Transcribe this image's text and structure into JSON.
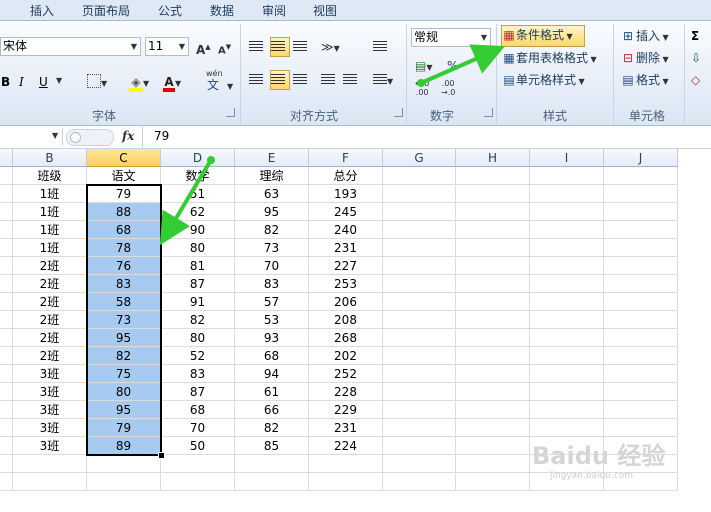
{
  "tabs": [
    "插入",
    "页面布局",
    "公式",
    "数据",
    "审阅",
    "视图"
  ],
  "font_group": {
    "font_name": "宋体",
    "font_size": "11",
    "label": "字体",
    "bold": "B",
    "italic": "I",
    "underline": "U",
    "font_color_letter": "A",
    "phonetic_top": "wén",
    "phonetic_char": "文"
  },
  "align_group": {
    "label": "对齐方式"
  },
  "number_group": {
    "format": "常规",
    "percent": "%",
    "label": "数字"
  },
  "style_group": {
    "conditional": "条件格式",
    "table_format": "套用表格格式",
    "cell_style": "单元格样式",
    "label": "样式"
  },
  "cells_group": {
    "insert": "插入",
    "delete": "删除",
    "format": "格式",
    "label": "单元格"
  },
  "formula_bar": {
    "fx": "fx",
    "value": "79"
  },
  "columns": [
    "B",
    "C",
    "D",
    "E",
    "F",
    "G",
    "H",
    "I",
    "J"
  ],
  "headers": [
    "班级",
    "语文",
    "数学",
    "理综",
    "总分"
  ],
  "rows": [
    [
      "1班",
      "79",
      "51",
      "63",
      "193"
    ],
    [
      "1班",
      "88",
      "62",
      "95",
      "245"
    ],
    [
      "1班",
      "68",
      "90",
      "82",
      "240"
    ],
    [
      "1班",
      "78",
      "80",
      "73",
      "231"
    ],
    [
      "2班",
      "76",
      "81",
      "70",
      "227"
    ],
    [
      "2班",
      "83",
      "87",
      "83",
      "253"
    ],
    [
      "2班",
      "58",
      "91",
      "57",
      "206"
    ],
    [
      "2班",
      "73",
      "82",
      "53",
      "208"
    ],
    [
      "2班",
      "95",
      "80",
      "93",
      "268"
    ],
    [
      "2班",
      "82",
      "52",
      "68",
      "202"
    ],
    [
      "3班",
      "75",
      "83",
      "94",
      "252"
    ],
    [
      "3班",
      "80",
      "87",
      "61",
      "228"
    ],
    [
      "3班",
      "95",
      "68",
      "66",
      "229"
    ],
    [
      "3班",
      "79",
      "70",
      "82",
      "231"
    ],
    [
      "3班",
      "89",
      "50",
      "85",
      "224"
    ]
  ],
  "watermark": {
    "brand": "Baidu 经验",
    "url": "jingyan.baidu.com"
  },
  "colors": {
    "selection": "#a6caf0",
    "arrow": "#33cc33",
    "highlight_button": "#ffd86b"
  }
}
